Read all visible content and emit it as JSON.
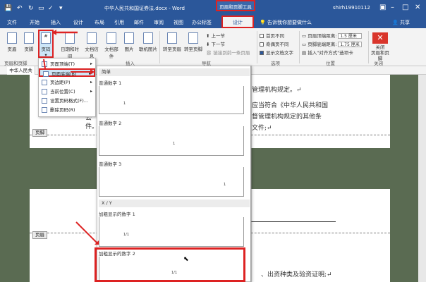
{
  "titlebar": {
    "doc_title": "中华人民共和国证券法.docx - Word",
    "context_group": "页眉和页脚工具",
    "user": "shirh19910112",
    "quick_access": [
      "save-icon",
      "undo-icon",
      "redo-icon",
      "print-icon",
      "spell-icon",
      "customize-icon"
    ],
    "window_buttons": [
      "ribbon-display-icon",
      "minimize-icon",
      "maximize-icon",
      "close-icon"
    ]
  },
  "tabs": {
    "file": "文件",
    "home": "开始",
    "insert": "插入",
    "design": "设计",
    "layout": "布局",
    "references": "引用",
    "mailings": "邮件",
    "review": "审阅",
    "view": "视图",
    "office_tab": "办公标签",
    "hf_design": "设计",
    "tell_me": "告诉我你想要做什么",
    "share": "共享"
  },
  "ribbon": {
    "header": "页眉",
    "footer": "页脚",
    "page_number": "页码",
    "datetime": "日期和时间",
    "docinfo": "文档信息",
    "docparts": "文档部件",
    "picture": "图片",
    "online_picture": "联机图片",
    "goto_header": "转至页眉",
    "goto_footer": "转至页脚",
    "prev_section": "上一节",
    "next_section": "下一节",
    "link_prev": "链接到前一条页眉",
    "first_page": "首页不同",
    "odd_even": "奇偶页不同",
    "show_doc_text": "显示文档文字",
    "header_top": "页眉顶端距离:",
    "header_top_value": "1.5 厘米",
    "footer_bottom": "页脚底端距离:",
    "footer_bottom_value": "1.75 厘米",
    "insert_align_tab": "插入\"对齐方式\"选项卡",
    "close_label": "关闭\n页眉和页脚",
    "group_hf": "页眉和页脚",
    "group_insert": "插入",
    "group_nav": "导航",
    "group_options": "选项",
    "group_position": "位置",
    "group_close": "关闭"
  },
  "navtab": "中华人民共",
  "doc": {
    "line1": "管理机构规定。↵",
    "line2": "应当符合《中华人民共和国",
    "line3": "督管理机构规定的其他条",
    "line4": "文件;↵",
    "frag_a": "公",
    "frag_b": "件。",
    "bottom_text": "、出资种类及验资证明;↵",
    "footer_label": "页脚",
    "header_label": "页眉"
  },
  "menu1": {
    "items": [
      {
        "label": "页面顶端(T)",
        "arrow": "▸"
      },
      {
        "label": "页面底端(B)",
        "arrow": "▸"
      },
      {
        "label": "页边距(P)",
        "arrow": "▸"
      },
      {
        "label": "当前位置(C)",
        "arrow": "▸"
      },
      {
        "label": "设置页码格式(F)...",
        "arrow": ""
      },
      {
        "label": "删除页码(R)",
        "arrow": ""
      }
    ]
  },
  "menu2": {
    "section_simple": "简单",
    "items": [
      {
        "title": "普通数字 1",
        "num": "1"
      },
      {
        "title": "普通数字 2",
        "num": "1"
      },
      {
        "title": "普通数字 3",
        "num": "1"
      }
    ],
    "section_xy": "X / Y",
    "bold1": {
      "title": "加粗显示的数字 1",
      "num": "1/1"
    },
    "bold2": {
      "title": "加粗显示的数字 2",
      "num": "1/1"
    }
  },
  "colors": {
    "brand": "#2b579a",
    "highlight": "#dd2222"
  }
}
